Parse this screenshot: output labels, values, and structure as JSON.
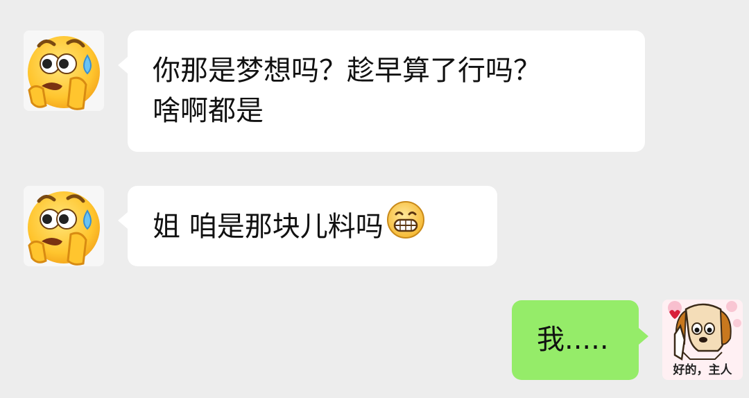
{
  "messages": [
    {
      "side": "incoming",
      "sender_avatar": "sweating-peeking-emoji-avatar",
      "text": "你那是梦想吗？趁早算了行吗？\n啥啊都是"
    },
    {
      "side": "incoming",
      "sender_avatar": "sweating-peeking-emoji-avatar",
      "text": "姐 咱是那块儿料吗",
      "trailing_emoji": "grinning-face-icon"
    },
    {
      "side": "outgoing",
      "sender_avatar": "dog-sticker-avatar",
      "text": "我.....",
      "avatar_caption": "好的，主人"
    }
  ],
  "colors": {
    "background": "#ededed",
    "incoming_bubble": "#ffffff",
    "outgoing_bubble": "#95ec69",
    "text": "#111111"
  }
}
